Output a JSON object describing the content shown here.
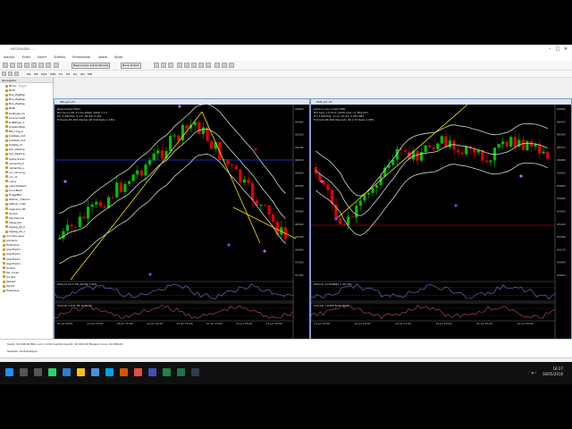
{
  "window": {
    "title": "METATRADER - ...",
    "controls": [
      "–",
      "□",
      "✕"
    ]
  },
  "menu": [
    "Arquivo",
    "Exibir",
    "Inserir",
    "Gráficos",
    "Ferramentas",
    "Janela",
    "Ajuda"
  ],
  "toolbar": {
    "algo_button": "Negociação Automatizada",
    "new_order_button": "Nova Ordem"
  },
  "timeframes": [
    "M1",
    "M5",
    "M15",
    "M30",
    "H1",
    "H4",
    "D1",
    "W1",
    "MN"
  ],
  "navigator": {
    "title": "Navegador",
    "items": [
      "Blocu...T_s_n",
      "BroE",
      "Bos_ZigZag",
      "Bos_ZigZag",
      "Bos_ZigZag",
      "BoBi",
      "bolllinge_lin",
      "boomcross8",
      "boBllinge_1",
      "breakoutbar",
      "BO_r.mg_h",
      "bubbles_dot",
      "bubbles_dot",
      "bubble_dr",
      "bar_wksline",
      "bar_wksline",
      "bybordrand",
      "camarilla_h",
      "camarilla_s",
      "ccc_divrong",
      "ccc_di",
      "cyme",
      "cypodibaters",
      "CounBack",
      "FrogeiBtrr",
      "keltner_channe",
      "keltner_chan",
      "Laguerre_RC",
      "larrain",
      "skychannel",
      "swag_ble",
      "zigzag_ab_h",
      "zigzag_ab_s",
      "Circuitor-spar",
      "Advisors",
      "Exemplos",
      "AlgoTradin",
      "AlgoTradin",
      "AlgoTradin",
      "AlgoTradin",
      "United",
      "Mo_mnet",
      "Scripts",
      "Market",
      "PlyTxt",
      "Exemplos"
    ],
    "tabs": [
      "Comum",
      "Favoritos"
    ]
  },
  "charts": [
    {
      "caption": "IND.g21,H1",
      "info": [
        "Negociação FR01",
        "Bid Lenço 89 4 Lote 2000/ 2000 =1 2",
        "Prc 3 REOTAJ- 3 Lot; 45.62/ 5.201",
        "Entrada 95 206 Marker 96 999 Rate 1.18%"
      ],
      "subwin1": "RSI(14) 52.3 FW_69 B9 1.250",
      "subwin2": "CCI(14) 1.631 85 1046 56",
      "dates": [
        "21 Jul 2019",
        "11 Jul 13:00",
        "14 Jul 15:00",
        "14 Jul 19:00",
        "21 Jul 15:00",
        "27 Jul 13:00",
        "21 Jul 14:00",
        "27 Jul 18:00"
      ]
    },
    {
      "caption": "WIN.g21,H1",
      "info": [
        "Libra Lo por ordem PER",
        "Bid Lerp 1 H Prot: 2008 Lote =1 PK2.001",
        "Prc 3 REOTAJ- 3 Lot; 42.52/ 2 PS1.881",
        "Entrada 96 999 Mercado 96 2.70 Rate 1.08%"
      ],
      "subwin1": "RSI(14) 14.546684 1 40.352",
      "subwin2": "CCI(14) 1.6458 8d45 8645",
      "dates": [
        "13 Jul 13:00",
        "13 Jul 19:00",
        "14 Jul 17:00",
        "14 Jul 18:00",
        "21 Jul 15:00",
        "21 Jul 18:00"
      ]
    }
  ],
  "chart_tabs": [
    "WINQ20,M5",
    "WDOQ20,M1",
    "BBAS3,Daily",
    "PETR4,M5",
    "CIEL3,Weekly",
    "CSNA3,Weekly",
    "ECOR3,Daily",
    "PETR4,Daily",
    "BVPQ,Daily",
    "CSNA3,Weekly",
    "ELET3,Weekly",
    "PETR3,Weekly",
    "RAIL3,Daily",
    "BRKM5,Weekly",
    "HYPE3,Weekly",
    "RAIL3,Weekly",
    "CIEL3,Weekly",
    "CMIG4,Weekly",
    "BBSE3,Weekly",
    "ITSA4,Weekly",
    "BVMF"
  ],
  "terminal": {
    "line1": "Saldo: 94 096.00 BRL  Lucro: 0.00  Capital Líquido: 94 096.00  Margem Livre: 94 096.00",
    "line2": "Testador de Estratégia"
  },
  "status": {
    "left": "Para Ajuda, pressione F1",
    "middle": "Default",
    "right": "1547 / 1 kb"
  },
  "taskbar": {
    "time": "18:27",
    "date": "30/05/2016"
  },
  "colors": {
    "bull": "#00c000",
    "bear": "#e00000",
    "band": "#c8e0c8",
    "level_blue": "#2040ff",
    "level_red": "#c00000",
    "trend": "#ffe600",
    "window_border": "#7a9bd1"
  }
}
